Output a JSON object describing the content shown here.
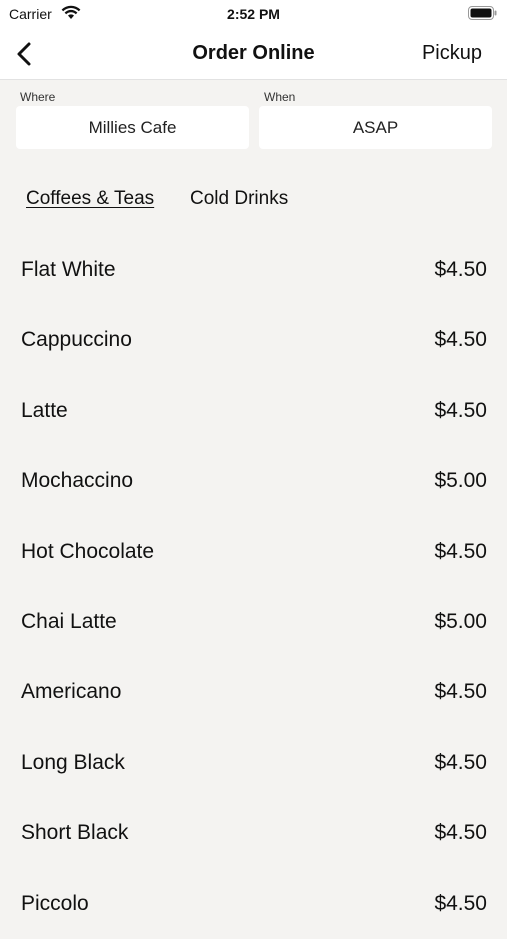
{
  "status_bar": {
    "carrier": "Carrier",
    "time": "2:52 PM"
  },
  "nav": {
    "title": "Order Online",
    "right_action": "Pickup"
  },
  "where": {
    "label": "Where",
    "value": "Millies Cafe"
  },
  "when": {
    "label": "When",
    "value": "ASAP"
  },
  "tabs": [
    {
      "label": "Coffees & Teas",
      "active": true
    },
    {
      "label": "Cold Drinks",
      "active": false
    }
  ],
  "menu_items": [
    {
      "name": "Flat White",
      "price": "$4.50"
    },
    {
      "name": "Cappuccino",
      "price": "$4.50"
    },
    {
      "name": "Latte",
      "price": "$4.50"
    },
    {
      "name": "Mochaccino",
      "price": "$5.00"
    },
    {
      "name": "Hot Chocolate",
      "price": "$4.50"
    },
    {
      "name": "Chai Latte",
      "price": "$5.00"
    },
    {
      "name": "Americano",
      "price": "$4.50"
    },
    {
      "name": "Long Black",
      "price": "$4.50"
    },
    {
      "name": "Short Black",
      "price": "$4.50"
    },
    {
      "name": "Piccolo",
      "price": "$4.50"
    }
  ],
  "colors": {
    "background": "#f4f3f1",
    "surface": "#ffffff",
    "text": "#111111"
  }
}
